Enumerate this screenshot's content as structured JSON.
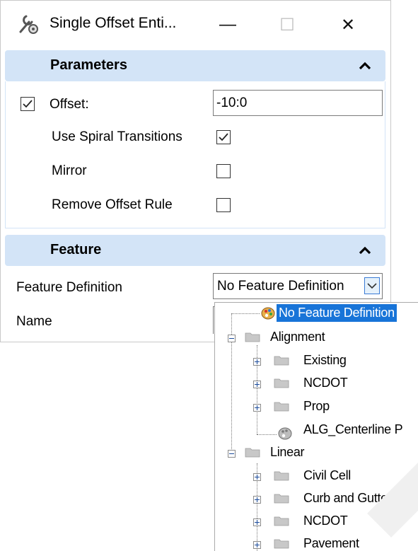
{
  "window": {
    "title": "Single Offset Enti...",
    "icon": "wrench-gear-icon",
    "controls": {
      "minimize": "—",
      "maximize": "☐",
      "close": "✕"
    }
  },
  "parameters": {
    "header": "Parameters",
    "offset": {
      "label": "Offset:",
      "value": "-10:0",
      "checked": true
    },
    "use_spiral": {
      "label": "Use Spiral Transitions",
      "checked": true
    },
    "mirror": {
      "label": "Mirror",
      "checked": false
    },
    "remove_offset_rule": {
      "label": "Remove Offset Rule",
      "checked": false
    }
  },
  "feature": {
    "header": "Feature",
    "definition_label": "Feature Definition",
    "definition_value": "No Feature Definition",
    "name_label": "Name"
  },
  "tree": {
    "items": [
      {
        "label": "No Feature Definition",
        "icon": "palette-icon",
        "selected": true
      },
      {
        "label": "Alignment",
        "icon": "folder-icon",
        "expanded": true
      },
      {
        "label": "Existing",
        "icon": "folder-icon"
      },
      {
        "label": "NCDOT",
        "icon": "folder-icon"
      },
      {
        "label": "Prop",
        "icon": "folder-icon"
      },
      {
        "label": "ALG_Centerline P",
        "icon": "palette-gray-icon"
      },
      {
        "label": "Linear",
        "icon": "folder-icon",
        "expanded": true
      },
      {
        "label": "Civil Cell",
        "icon": "folder-icon"
      },
      {
        "label": "Curb and Gutter",
        "icon": "folder-icon"
      },
      {
        "label": "NCDOT",
        "icon": "folder-icon"
      },
      {
        "label": "Pavement",
        "icon": "folder-icon"
      }
    ]
  },
  "colors": {
    "header_bg": "#d3e4f7",
    "selection": "#1874d8",
    "folder": "#c8c8c8"
  }
}
